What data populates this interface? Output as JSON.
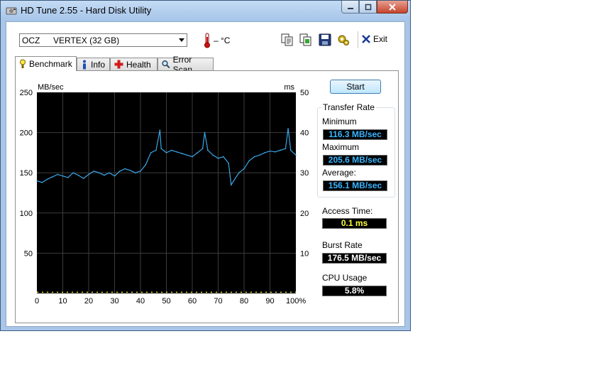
{
  "window": {
    "title": "HD Tune 2.55 - Hard Disk Utility"
  },
  "toolbar": {
    "drive_name": "OCZ",
    "drive_model": "VERTEX (32 GB)",
    "temperature": "– °C",
    "exit_label": "Exit",
    "icons": [
      "copy-info-icon",
      "copy-screenshot-icon",
      "save-icon",
      "options-icon",
      "exit-icon"
    ]
  },
  "tabs": [
    {
      "label": "Benchmark",
      "icon": "benchmark-icon",
      "active": true
    },
    {
      "label": "Info",
      "icon": "info-icon",
      "active": false
    },
    {
      "label": "Health",
      "icon": "health-icon",
      "active": false
    },
    {
      "label": "Error Scan",
      "icon": "error-scan-icon",
      "active": false
    }
  ],
  "benchmark": {
    "start_label": "Start",
    "transfer_rate_title": "Transfer Rate",
    "minimum_label": "Minimum",
    "minimum_value": "116.3 MB/sec",
    "maximum_label": "Maximum",
    "maximum_value": "205.6 MB/sec",
    "average_label": "Average:",
    "average_value": "156.1 MB/sec",
    "access_time_label": "Access Time:",
    "access_time_value": "0.1 ms",
    "burst_rate_label": "Burst Rate",
    "burst_rate_value": "176.5 MB/sec",
    "cpu_usage_label": "CPU Usage",
    "cpu_usage_value": "5.8%"
  },
  "colors": {
    "plot_background": "#000000",
    "grid": "#3c3c3c",
    "transfer_line": "#3aa6e8",
    "access_marks": "#e6e63c",
    "value_blue": "#3ab6ff",
    "value_yellow": "#ffff3c"
  },
  "chart_data": {
    "type": "line",
    "xlabel": "",
    "ylabel_left": "MB/sec",
    "ylabel_right": "ms",
    "ylim": [
      0,
      250
    ],
    "ylim_right": [
      0,
      50
    ],
    "xlim": [
      0,
      100
    ],
    "left_ticks": [
      50,
      100,
      150,
      200,
      250
    ],
    "right_ticks": [
      10,
      20,
      30,
      40,
      50
    ],
    "x_ticks": [
      "0",
      "10",
      "20",
      "30",
      "40",
      "50",
      "60",
      "70",
      "80",
      "90",
      "100%"
    ],
    "grid": true,
    "series": [
      {
        "x": [
          0,
          2,
          4,
          6,
          8,
          10,
          12,
          14,
          16,
          18,
          20,
          22,
          24,
          26,
          28,
          30,
          32,
          34,
          36,
          38,
          40,
          42,
          44,
          46,
          47.5,
          48,
          50,
          52,
          54,
          56,
          58,
          60,
          62,
          64,
          64.8,
          66,
          68,
          70,
          72,
          74,
          75,
          76,
          78,
          80,
          82,
          84,
          86,
          88,
          90,
          92,
          94,
          96,
          97,
          98,
          100
        ],
        "y": [
          140,
          138,
          142,
          145,
          148,
          146,
          144,
          150,
          147,
          143,
          148,
          152,
          150,
          147,
          150,
          146,
          152,
          155,
          153,
          150,
          152,
          160,
          175,
          178,
          203,
          180,
          175,
          178,
          176,
          174,
          172,
          170,
          175,
          180,
          200,
          178,
          172,
          168,
          170,
          162,
          135,
          140,
          150,
          155,
          165,
          170,
          172,
          175,
          177,
          176,
          178,
          180,
          205,
          178,
          172
        ]
      },
      {
        "x": [
          0,
          100
        ],
        "y": [
          0.1,
          0.1
        ]
      }
    ]
  }
}
